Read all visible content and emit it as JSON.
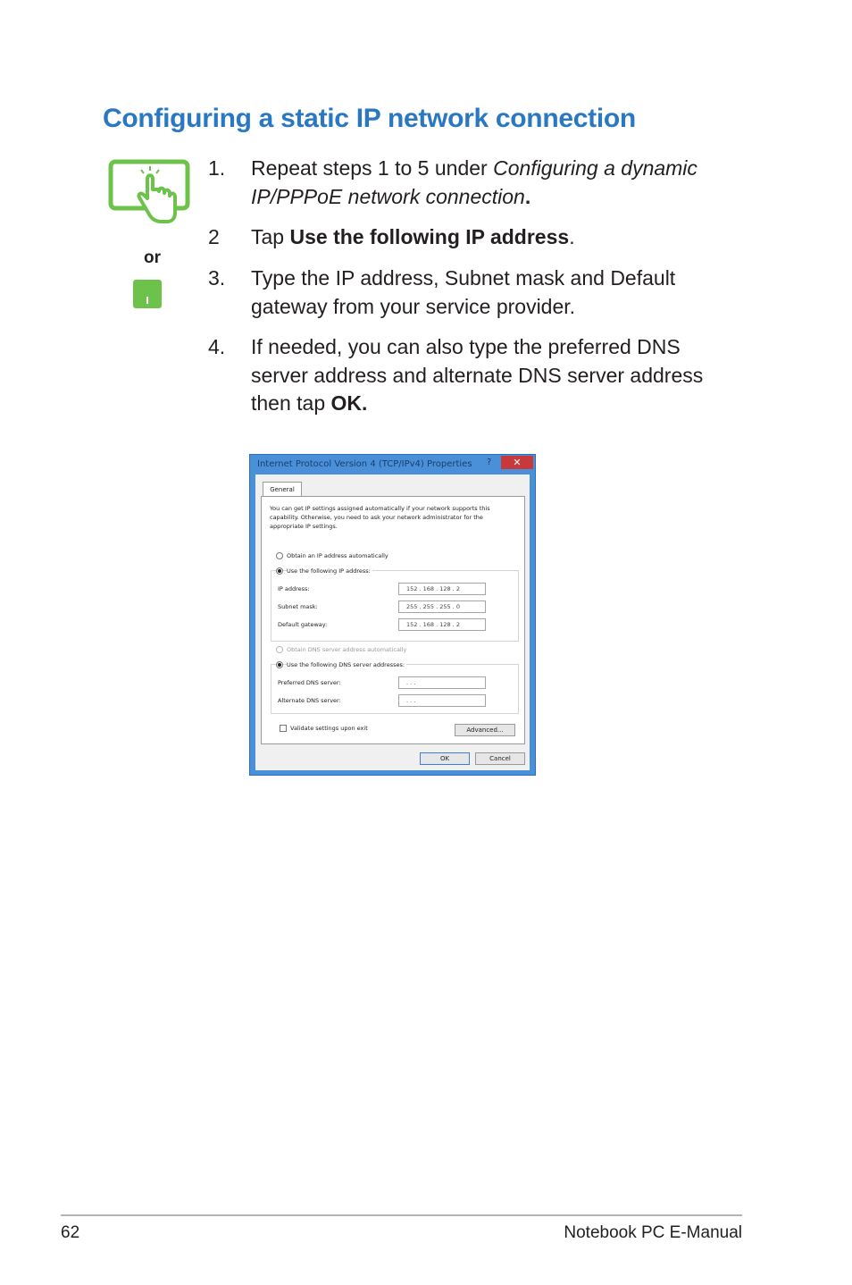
{
  "heading": "Configuring a static IP network connection",
  "or_label": "or",
  "steps": [
    {
      "num": "1.",
      "pre": "Repeat steps 1 to 5 under ",
      "italic": "Configuring a dynamic IP/PPPoE network connection",
      "post": "."
    },
    {
      "num": "2",
      "pre": "Tap ",
      "bold": "Use the following IP address",
      "post": "."
    },
    {
      "num": "3.",
      "text": "Type the IP address, Subnet mask and Default gateway from your service provider."
    },
    {
      "num": "4.",
      "pre": "If needed, you can also type the preferred DNS server address and alternate DNS server address then tap ",
      "bold": "OK."
    }
  ],
  "dialog": {
    "title": "Internet Protocol Version 4 (TCP/IPv4) Properties",
    "help": "?",
    "close": "✕",
    "tab": "General",
    "description": "You can get IP settings assigned automatically if your network supports this capability. Otherwise, you need to ask your network administrator for the appropriate IP settings.",
    "obtain_ip_auto": "Obtain an IP address automatically",
    "use_following_ip": "Use the following IP address:",
    "ip_label": "IP address:",
    "ip_value": "152 . 168 . 128 .   2",
    "subnet_label": "Subnet mask:",
    "subnet_value": "255 . 255 . 255 .   0",
    "gateway_label": "Default gateway:",
    "gateway_value": "152 . 168 . 128 .   2",
    "obtain_dns_auto": "Obtain DNS server address automatically",
    "use_following_dns": "Use the following DNS server addresses:",
    "preferred_dns_label": "Preferred DNS server:",
    "preferred_dns_value": "  .      .      .",
    "alternate_dns_label": "Alternate DNS server:",
    "alternate_dns_value": "  .      .      .",
    "validate": "Validate settings upon exit",
    "advanced": "Advanced...",
    "ok": "OK",
    "cancel": "Cancel"
  },
  "footer": {
    "page_number": "62",
    "title": "Notebook PC E-Manual"
  },
  "colors": {
    "heading": "#2a78c2",
    "icon_green": "#6cc24a",
    "dialog_frame": "#4a90d9",
    "close_red": "#c7393a"
  }
}
